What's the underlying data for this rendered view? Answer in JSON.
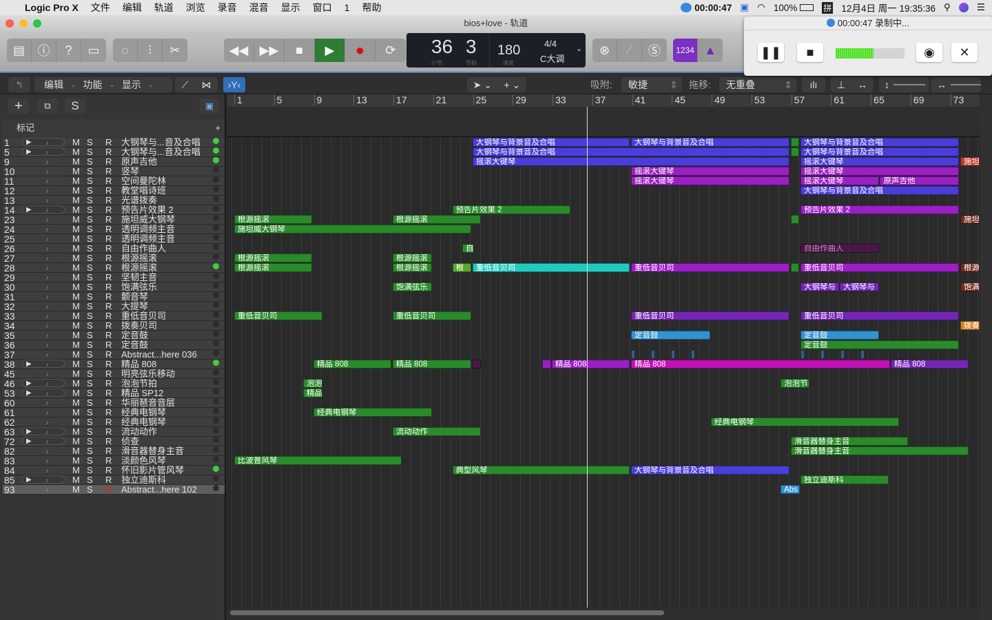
{
  "menubar": {
    "app": "Logic Pro X",
    "items": [
      "文件",
      "编辑",
      "轨道",
      "浏览",
      "录音",
      "混音",
      "显示",
      "窗口",
      "1",
      "帮助"
    ],
    "rec_time": "00:00:47",
    "battery": "100%",
    "ime": "拼",
    "datetime": "12月4日 周一  19:35:36"
  },
  "window": {
    "title": "bios+love - 轨道"
  },
  "lcd": {
    "bar": "36",
    "beat": "3",
    "bar_label": "小节",
    "beat_label": "节拍",
    "tempo": "180",
    "tempo_label": "速度",
    "signature": "4/4",
    "key": "C大调"
  },
  "toolbar": {
    "count_in": "1234"
  },
  "subbar": {
    "edit": "编辑",
    "functions": "功能",
    "view": "显示",
    "snap_label": "吸附:",
    "snap_value": "敏捷",
    "drag_label": "拖移:",
    "drag_value": "无重叠"
  },
  "tracklist": {
    "markers_label": "标记",
    "s_label": "S"
  },
  "recorder": {
    "title": "00:00:47 录制中...",
    "level": 0.55
  },
  "ruler": {
    "labels": [
      "1",
      "5",
      "9",
      "13",
      "17",
      "21",
      "25",
      "29",
      "33",
      "37",
      "41",
      "45",
      "49",
      "53",
      "57",
      "61",
      "65",
      "69",
      "73"
    ]
  },
  "playhead_bar": 36.7,
  "colors": {
    "blue": "#4a3ed8",
    "magenta": "#9a1fc4",
    "green": "#2b8a2b",
    "lgreen": "#5aa82a",
    "cyan": "#22c9bf",
    "red": "#c0392b",
    "brown": "#6e2d22",
    "orange": "#d8822a",
    "sky": "#3392d0",
    "purple": "#7326b3",
    "pink": "#c012b4",
    "dpurple": "#4a1848",
    "steel": "#3a5a80"
  },
  "tracks": [
    {
      "num": "1",
      "name": "大钢琴与...音及合唱",
      "folder": true,
      "on": true
    },
    {
      "num": "5",
      "name": "大钢琴与...音及合唱",
      "folder": true,
      "on": true
    },
    {
      "num": "9",
      "name": "原声吉他",
      "folder": false,
      "on": true
    },
    {
      "num": "10",
      "name": "竖琴",
      "folder": false,
      "on": false
    },
    {
      "num": "11",
      "name": "空间曼陀林",
      "folder": false,
      "on": false
    },
    {
      "num": "12",
      "name": "教堂唱诗班",
      "folder": false,
      "on": false
    },
    {
      "num": "13",
      "name": "光谱拨奏",
      "folder": false,
      "on": false
    },
    {
      "num": "14",
      "name": "预告片效果 2",
      "folder": true,
      "on": false
    },
    {
      "num": "23",
      "name": "施坦威大钢琴",
      "folder": false,
      "on": false
    },
    {
      "num": "24",
      "name": "透明调频主音",
      "folder": false,
      "on": false
    },
    {
      "num": "25",
      "name": "透明调频主音",
      "folder": false,
      "on": false
    },
    {
      "num": "26",
      "name": "自由作曲人",
      "folder": false,
      "on": false
    },
    {
      "num": "27",
      "name": "根源摇滚",
      "folder": false,
      "on": false
    },
    {
      "num": "28",
      "name": "根源摇滚",
      "folder": false,
      "on": true
    },
    {
      "num": "29",
      "name": "坚韧主音",
      "folder": false,
      "on": false
    },
    {
      "num": "30",
      "name": "饱满弦乐",
      "folder": false,
      "on": false
    },
    {
      "num": "31",
      "name": "颤音琴",
      "folder": false,
      "on": false
    },
    {
      "num": "32",
      "name": "大提琴",
      "folder": false,
      "on": false
    },
    {
      "num": "33",
      "name": "重低音贝司",
      "folder": false,
      "on": false
    },
    {
      "num": "34",
      "name": "拨奏贝司",
      "folder": false,
      "on": false
    },
    {
      "num": "35",
      "name": "定音鼓",
      "folder": false,
      "on": false
    },
    {
      "num": "36",
      "name": "定音鼓",
      "folder": false,
      "on": false
    },
    {
      "num": "37",
      "name": "Abstract...here 036",
      "folder": false,
      "on": false
    },
    {
      "num": "38",
      "name": "精品 808",
      "folder": true,
      "on": true
    },
    {
      "num": "45",
      "name": "明亮弦乐移动",
      "folder": false,
      "on": false
    },
    {
      "num": "46",
      "name": "泡泡节拍",
      "folder": true,
      "on": false
    },
    {
      "num": "53",
      "name": "精品 SP12",
      "folder": true,
      "on": false
    },
    {
      "num": "60",
      "name": "华丽琶音音层",
      "folder": false,
      "on": false
    },
    {
      "num": "61",
      "name": "经典电钢琴",
      "folder": false,
      "on": false
    },
    {
      "num": "62",
      "name": "经典电钢琴",
      "folder": false,
      "on": false
    },
    {
      "num": "63",
      "name": "流动动作",
      "folder": true,
      "on": false
    },
    {
      "num": "72",
      "name": "侦查",
      "folder": true,
      "on": false
    },
    {
      "num": "82",
      "name": "滑音器替身主音",
      "folder": false,
      "on": false
    },
    {
      "num": "83",
      "name": "淡颜色风琴",
      "folder": false,
      "on": false
    },
    {
      "num": "84",
      "name": "怀旧影片管风琴",
      "folder": false,
      "on": true
    },
    {
      "num": "85",
      "name": "独立迪斯科",
      "folder": true,
      "on": false
    },
    {
      "num": "93",
      "name": "Abstract...here 102",
      "folder": false,
      "on": false,
      "selected": true
    }
  ],
  "regions": [
    [
      0,
      25.24,
      41.03,
      "大钢琴与背景音及合唱",
      "blue"
    ],
    [
      0,
      41.17,
      57.1,
      "大钢琴与背景音及合唱",
      "blue"
    ],
    [
      0,
      57.23,
      58.06,
      "",
      "green"
    ],
    [
      0,
      58.2,
      74.1,
      "大钢琴与背景音及合唱",
      "blue"
    ],
    [
      1,
      25.24,
      57.1,
      "大钢琴与背景音及合唱",
      "blue"
    ],
    [
      1,
      57.23,
      58.06,
      "",
      "green"
    ],
    [
      1,
      58.2,
      74.1,
      "大钢琴与背景音及合唱",
      "blue"
    ],
    [
      2,
      25.24,
      57.1,
      "摇滚大键琴",
      "blue"
    ],
    [
      2,
      58.2,
      74.1,
      "摇滚大键琴",
      "blue"
    ],
    [
      2,
      74.27,
      76.2,
      "施坦",
      "red"
    ],
    [
      3,
      41.17,
      57.1,
      "摇滚大键琴",
      "magenta"
    ],
    [
      3,
      58.2,
      74.1,
      "摇滚大键琴",
      "magenta"
    ],
    [
      4,
      41.17,
      57.1,
      "摇滚大键琴",
      "magenta"
    ],
    [
      4,
      58.2,
      66.1,
      "摇滚大键琴",
      "magenta"
    ],
    [
      4,
      66.2,
      74.1,
      "原声吉他",
      "magenta"
    ],
    [
      5,
      58.2,
      74.1,
      "大钢琴与背景音及合唱",
      "blue"
    ],
    [
      7,
      23.2,
      35.07,
      "预告片效果 2",
      "green"
    ],
    [
      7,
      58.2,
      74.1,
      "预告片效果 2",
      "magenta"
    ],
    [
      8,
      1.28,
      9.1,
      "根源摇滚",
      "green"
    ],
    [
      8,
      17.2,
      26.07,
      "根源摇滚",
      "green"
    ],
    [
      8,
      57.23,
      58.06,
      "",
      "green"
    ],
    [
      8,
      74.27,
      76.2,
      "施坦",
      "brown"
    ],
    [
      9,
      1.28,
      25.1,
      "施坦威大钢琴",
      "green"
    ],
    [
      11,
      24.2,
      25.4,
      "自",
      "green"
    ],
    [
      11,
      58.2,
      66.1,
      "自由作曲人",
      "dpurple"
    ],
    [
      12,
      1.28,
      9.1,
      "根源摇滚",
      "green"
    ],
    [
      12,
      17.2,
      21.15,
      "根源摇滚",
      "green"
    ],
    [
      13,
      1.28,
      9.1,
      "根源摇滚",
      "green"
    ],
    [
      13,
      17.2,
      21.15,
      "根源摇滚",
      "green"
    ],
    [
      13,
      23.2,
      25.1,
      "根",
      "lgreen"
    ],
    [
      13,
      25.24,
      41.03,
      "重低音贝司",
      "cyan"
    ],
    [
      13,
      41.17,
      57.1,
      "重低音贝司",
      "magenta"
    ],
    [
      13,
      57.23,
      58.06,
      "",
      "green"
    ],
    [
      13,
      58.2,
      74.1,
      "重低音贝司",
      "magenta"
    ],
    [
      13,
      74.27,
      76.2,
      "根源:",
      "brown"
    ],
    [
      15,
      17.2,
      21.15,
      "饱满弦乐",
      "green"
    ],
    [
      15,
      58.2,
      62.08,
      "大钢琴与",
      "purple"
    ],
    [
      15,
      62.15,
      66.1,
      "大钢琴与",
      "purple"
    ],
    [
      15,
      74.27,
      76.2,
      "饱满",
      "brown"
    ],
    [
      18,
      1.28,
      10.14,
      "重低音贝司",
      "green"
    ],
    [
      18,
      17.2,
      25.1,
      "重低音贝司",
      "green"
    ],
    [
      18,
      41.17,
      57.1,
      "重低音贝司",
      "purple"
    ],
    [
      18,
      58.2,
      74.1,
      "重低音贝司",
      "purple"
    ],
    [
      19,
      74.27,
      76.2,
      "拨奏",
      "orange"
    ],
    [
      20,
      41.17,
      49.1,
      "定音鼓",
      "sky"
    ],
    [
      20,
      58.2,
      66.1,
      "定音鼓",
      "sky"
    ],
    [
      21,
      58.2,
      74.1,
      "定音鼓",
      "green"
    ],
    [
      22,
      41.17,
      41.6,
      "",
      "steel"
    ],
    [
      22,
      43.2,
      43.6,
      "",
      "steel"
    ],
    [
      22,
      45.2,
      45.6,
      "",
      "steel"
    ],
    [
      22,
      47.2,
      47.6,
      "",
      "steel"
    ],
    [
      22,
      58.2,
      58.6,
      "",
      "steel"
    ],
    [
      22,
      60.2,
      60.6,
      "",
      "steel"
    ],
    [
      22,
      62.2,
      62.6,
      "",
      "steel"
    ],
    [
      22,
      64.2,
      64.6,
      "",
      "steel"
    ],
    [
      23,
      9.24,
      17.1,
      "精品 808",
      "green"
    ],
    [
      23,
      17.2,
      25.1,
      "精品 808",
      "green"
    ],
    [
      23,
      25.15,
      26.07,
      "",
      "dpurple"
    ],
    [
      23,
      32.2,
      33.1,
      "",
      "magenta"
    ],
    [
      23,
      33.2,
      41.03,
      "精品 808",
      "magenta"
    ],
    [
      23,
      41.17,
      67.2,
      "精品 808",
      "pink"
    ],
    [
      23,
      67.27,
      75.1,
      "精品 808",
      "purple"
    ],
    [
      25,
      8.2,
      10.14,
      "泡泡",
      "green"
    ],
    [
      25,
      56.2,
      59.1,
      "泡泡节",
      "green"
    ],
    [
      26,
      8.2,
      10.14,
      "精品",
      "green"
    ],
    [
      28,
      9.24,
      21.15,
      "经典电钢琴",
      "green"
    ],
    [
      29,
      49.2,
      68.1,
      "经典电钢琴",
      "green"
    ],
    [
      30,
      17.2,
      26.07,
      "流动动作",
      "green"
    ],
    [
      31,
      57.23,
      69.0,
      "滑音器替身主音",
      "green"
    ],
    [
      32,
      57.23,
      75.1,
      "滑音器替身主音",
      "green"
    ],
    [
      33,
      1.28,
      18.1,
      "比波普风琴",
      "green"
    ],
    [
      34,
      23.2,
      41.03,
      "典型风琴",
      "green"
    ],
    [
      34,
      41.17,
      57.1,
      "大钢琴与背景音及合唱",
      "blue"
    ],
    [
      35,
      58.2,
      67.07,
      "独立迪斯科",
      "green"
    ],
    [
      36,
      56.2,
      58.13,
      "Abs",
      "sky"
    ]
  ]
}
